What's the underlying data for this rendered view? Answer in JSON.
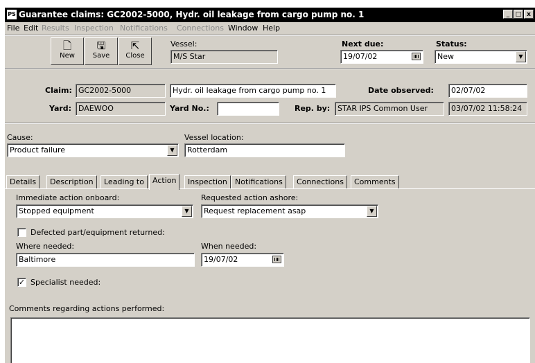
{
  "window": {
    "app_icon": "PS",
    "title": "Guarantee claims: GC2002-5000, Hydr. oil leakage from cargo pump no. 1",
    "controls": [
      "_",
      "□",
      "x"
    ]
  },
  "menu": [
    {
      "label": "File",
      "enabled": true
    },
    {
      "label": "Edit",
      "enabled": true
    },
    {
      "label": "Results",
      "enabled": false
    },
    {
      "label": "Inspection",
      "enabled": false
    },
    {
      "label": "Notifications",
      "enabled": false
    },
    {
      "label": "Connections",
      "enabled": false
    },
    {
      "label": "Window",
      "enabled": true
    },
    {
      "label": "Help",
      "enabled": true
    }
  ],
  "toolbar": {
    "new_label": "New",
    "new_icon": "document-icon",
    "save_label": "Save",
    "save_icon": "floppy-icon",
    "close_label": "Close",
    "close_icon": "door-exit-icon"
  },
  "vessel": {
    "label": "Vessel:",
    "value": "M/S Star"
  },
  "next_due": {
    "label": "Next due:",
    "value": "19/07/02"
  },
  "status": {
    "label": "Status:",
    "value": "New"
  },
  "claim": {
    "claim_label": "Claim:",
    "claim_value": "GC2002-5000",
    "title_value": "Hydr. oil leakage from cargo pump no. 1",
    "date_observed_label": "Date observed:",
    "date_observed_value": "02/07/02",
    "yard_label": "Yard:",
    "yard_value": "DAEWOO",
    "yard_no_label": "Yard No.:",
    "yard_no_value": "",
    "rep_by_label": "Rep. by:",
    "rep_by_value": "STAR IPS Common User",
    "rep_date_value": "03/07/02 11:58:24"
  },
  "cause": {
    "label": "Cause:",
    "value": "Product failure"
  },
  "vessel_location": {
    "label": "Vessel location:",
    "value": "Rotterdam"
  },
  "tabs": [
    "Details",
    "Description",
    "Leading to",
    "Action",
    "Inspection",
    "Notifications",
    "Connections",
    "Comments"
  ],
  "active_tab": "Action",
  "action": {
    "immediate_label": "Immediate action onboard:",
    "immediate_value": "Stopped equipment",
    "requested_label": "Requested action ashore:",
    "requested_value": "Request replacement asap",
    "defected_label": "Defected part/equipment returned:",
    "defected_checked": false,
    "where_label": "Where needed:",
    "where_value": "Baltimore",
    "when_label": "When needed:",
    "when_value": "19/07/02",
    "specialist_label": "Specialist needed:",
    "specialist_checked": true,
    "checkmark": "✓",
    "comments_label": "Comments regarding actions performed:",
    "comments_value": ""
  }
}
